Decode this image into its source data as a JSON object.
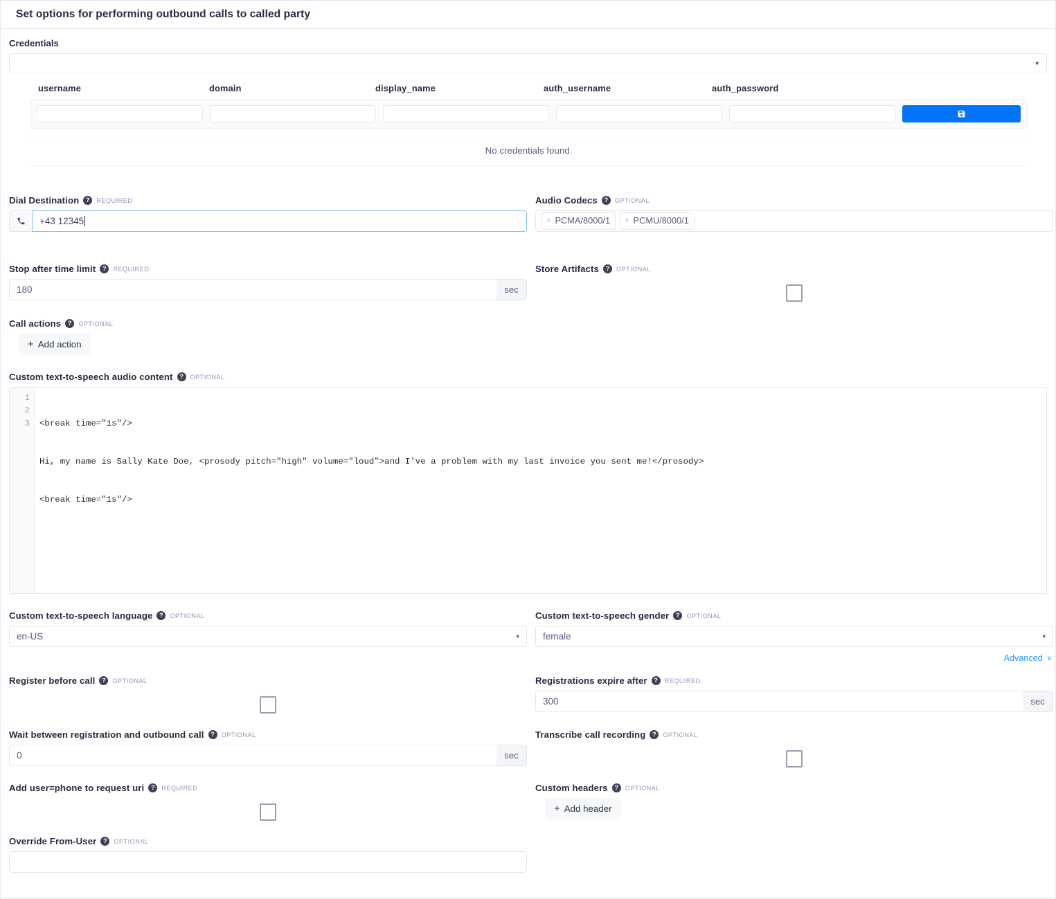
{
  "header": {
    "title": "Set options for performing outbound calls to called party"
  },
  "credentials": {
    "label": "Credentials",
    "select_value": "",
    "columns": [
      "username",
      "domain",
      "display_name",
      "auth_username",
      "auth_password"
    ],
    "row_values": [
      "",
      "",
      "",
      "",
      ""
    ],
    "save_icon": "save-floppy-icon",
    "empty_text": "No credentials found."
  },
  "fields": {
    "dial_destination": {
      "label": "Dial Destination",
      "badge": "REQUIRED",
      "icon": "phone-icon",
      "value": "+43 12345"
    },
    "audio_codecs": {
      "label": "Audio Codecs",
      "badge": "OPTIONAL",
      "tags": [
        "PCMA/8000/1",
        "PCMU/8000/1"
      ],
      "remove_glyph": "×"
    },
    "stop_after_time_limit": {
      "label": "Stop after time limit",
      "badge": "REQUIRED",
      "value": "180",
      "unit": "sec"
    },
    "store_artifacts": {
      "label": "Store Artifacts",
      "badge": "OPTIONAL",
      "checked": false
    },
    "call_actions": {
      "label": "Call actions",
      "badge": "OPTIONAL",
      "add_button": "Add action"
    },
    "tts_content": {
      "label": "Custom text-to-speech audio content",
      "badge": "OPTIONAL",
      "lines": [
        "<break time=\"1s\"/>",
        "Hi, my name is Sally Kate Doe, <prosody pitch=\"high\" volume=\"loud\">and I've a problem with my last invoice you sent me!</prosody>",
        "<break time=\"1s\"/>"
      ],
      "line_numbers": [
        "1",
        "2",
        "3"
      ]
    },
    "tts_language": {
      "label": "Custom text-to-speech language",
      "badge": "OPTIONAL",
      "value": "en-US"
    },
    "tts_gender": {
      "label": "Custom text-to-speech gender",
      "badge": "OPTIONAL",
      "value": "female"
    },
    "advanced": {
      "label": "Advanced",
      "chevron": "chevron-down-icon"
    },
    "register_before_call": {
      "label": "Register before call",
      "badge": "OPTIONAL",
      "checked": false
    },
    "registrations_expire_after": {
      "label": "Registrations expire after",
      "badge": "REQUIRED",
      "value": "300",
      "unit": "sec"
    },
    "wait_between_registration": {
      "label": "Wait between registration and outbound call",
      "badge": "OPTIONAL",
      "value": "0",
      "unit": "sec"
    },
    "transcribe_call_recording": {
      "label": "Transcribe call recording",
      "badge": "OPTIONAL",
      "checked": false
    },
    "add_user_phone": {
      "label": "Add user=phone to request uri",
      "badge": "REQUIRED",
      "checked": false
    },
    "custom_headers": {
      "label": "Custom headers",
      "badge": "OPTIONAL",
      "add_button": "Add header"
    },
    "override_from_user": {
      "label": "Override From-User",
      "badge": "OPTIONAL",
      "value": ""
    }
  },
  "colors": {
    "accent_blue": "#0274fa",
    "link_blue": "#2c99ff",
    "text_dark": "#272b41",
    "border": "#e3e6ef"
  },
  "glyphs": {
    "help": "?",
    "plus": "+",
    "caret_down": "▾",
    "chevron": "∨"
  }
}
